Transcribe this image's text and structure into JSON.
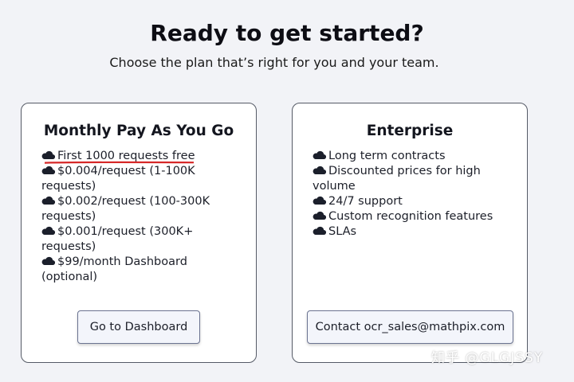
{
  "header": {
    "title": "Ready to get started?",
    "subtitle": "Choose the plan that’s right for you and your team."
  },
  "plans": [
    {
      "title": "Monthly Pay As You Go",
      "features": [
        "First 1000 requests free",
        "$0.004/request (1-100K requests)",
        "$0.002/request (100-300K requests)",
        "$0.001/request (300K+ requests)",
        "$99/month Dashboard (optional)"
      ],
      "button_label": "Go to Dashboard"
    },
    {
      "title": "Enterprise",
      "features": [
        "Long term contracts",
        "Discounted prices for high volume",
        "24/7 support",
        "Custom recognition features",
        "SLAs"
      ],
      "button_label": "Contact ocr_sales@mathpix.com"
    }
  ],
  "bullet_icon": "cloud-icon",
  "colors": {
    "background": "#f2f3f7",
    "card_border": "#555a66",
    "underline_annotation": "#d62828",
    "button_bg": "#f3f5fb",
    "button_border": "#6b7391"
  },
  "watermark": "知乎 @GLGJSSY"
}
